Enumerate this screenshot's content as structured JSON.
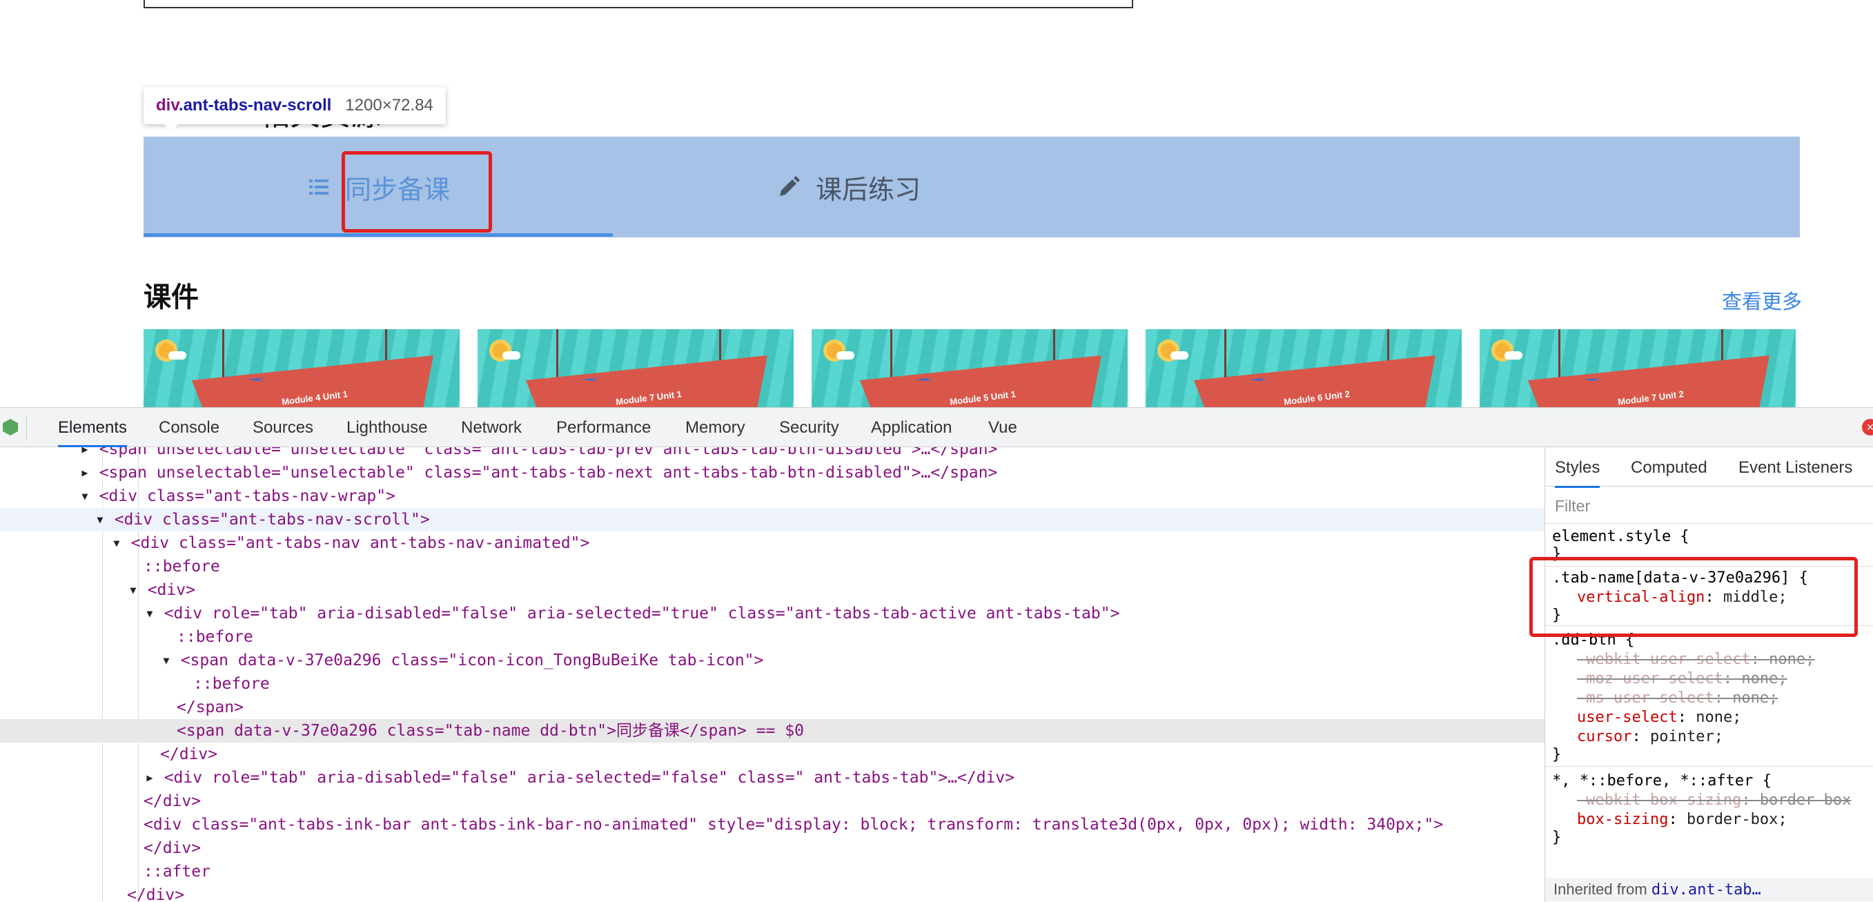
{
  "page": {
    "section_title": "相关资源",
    "tooltip": {
      "tag": "div",
      "class": ".ant-tabs-nav-scroll",
      "size": "1200×72.84"
    },
    "tabs": [
      {
        "label": "同步备课",
        "icon": "list-icon",
        "active": true
      },
      {
        "label": "课后练习",
        "icon": "pencil-icon",
        "active": false
      }
    ],
    "courses_title": "课件",
    "more_link": "查看更多",
    "thumbnails": [
      {
        "label": "Module 4  Unit 1"
      },
      {
        "label": "Module 7  Unit 1"
      },
      {
        "label": "Module 5  Unit 1"
      },
      {
        "label": "Module 6  Unit 2"
      },
      {
        "label": "Module 7  Unit 2"
      }
    ],
    "colors": {
      "tab_bar": "#a6c2e6",
      "active_tab": "#5b93d8",
      "highlight": "#e02020",
      "link": "#3a86e0"
    }
  },
  "devtools": {
    "tabs": [
      "Elements",
      "Console",
      "Sources",
      "Lighthouse",
      "Network",
      "Performance",
      "Memory",
      "Security",
      "Application",
      "Vue"
    ],
    "active_tab": "Elements",
    "dom_lines": [
      "<span unselectable=\"unselectable\" class=\"ant-tabs-tab-prev ant-tabs-tab-btn-disabled\">…</span>",
      "<span unselectable=\"unselectable\" class=\"ant-tabs-tab-next ant-tabs-tab-btn-disabled\">…</span>",
      "<div class=\"ant-tabs-nav-wrap\">",
      "<div class=\"ant-tabs-nav-scroll\">",
      "<div class=\"ant-tabs-nav ant-tabs-nav-animated\">",
      "::before",
      "<div>",
      "<div role=\"tab\" aria-disabled=\"false\" aria-selected=\"true\" class=\"ant-tabs-tab-active ant-tabs-tab\">",
      "::before",
      "<span data-v-37e0a296 class=\"icon-icon_TongBuBeiKe tab-icon\">",
      "::before",
      "</span>",
      "<span data-v-37e0a296 class=\"tab-name dd-btn\">同步备课</span> == $0",
      "</div>",
      "<div role=\"tab\" aria-disabled=\"false\" aria-selected=\"false\" class=\" ant-tabs-tab\">…</div>",
      "</div>",
      "<div class=\"ant-tabs-ink-bar ant-tabs-ink-bar-no-animated\" style=\"display: block; transform: translate3d(0px, 0px, 0px); width: 340px;\">",
      "</div>",
      "::after",
      "</div>"
    ],
    "styles_tabs": [
      "Styles",
      "Computed",
      "Event Listeners"
    ],
    "filter_placeholder": "Filter",
    "rules": {
      "element_style": "element.style {",
      "tab_name_selector": ".tab-name[data-v-37e0a296] {",
      "tab_name_prop": "vertical-align",
      "tab_name_val": "middle;",
      "dd_btn_selector": ".dd-btn {",
      "dd_btn_props": [
        {
          "prop": "-webkit-user-select",
          "val": "none;",
          "struck": true
        },
        {
          "prop": "-moz-user-select",
          "val": "none;",
          "struck": true
        },
        {
          "prop": "-ms-user-select",
          "val": "none;",
          "struck": true
        },
        {
          "prop": "user-select",
          "val": "none;",
          "struck": false
        },
        {
          "prop": "cursor",
          "val": "pointer;",
          "struck": false
        }
      ],
      "universal_selector": "*, *::before, *::after {",
      "universal_props": [
        {
          "prop": "-webkit-box-sizing",
          "val": "border-box",
          "struck": true
        },
        {
          "prop": "box-sizing",
          "val": "border-box;",
          "struck": false
        }
      ],
      "close_brace": "}",
      "inherited_from": "Inherited from",
      "inherited_selector": "div.ant-tab…"
    }
  }
}
